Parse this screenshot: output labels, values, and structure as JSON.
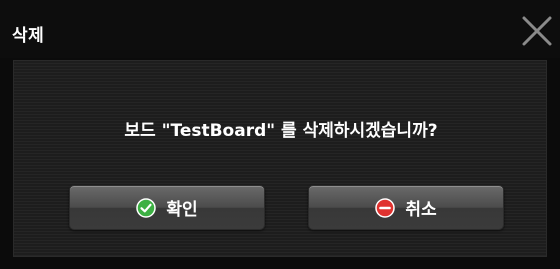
{
  "dialog": {
    "title": "삭제",
    "message": "보드 \"TestBoard\" 를 삭제하시겠습니까?",
    "buttons": {
      "confirm_label": "확인",
      "cancel_label": "취소"
    },
    "icons": {
      "close": "close-icon",
      "confirm": "check-circle-icon",
      "cancel": "minus-circle-icon"
    },
    "colors": {
      "confirm_icon": "#3cb043",
      "cancel_icon": "#e0322f"
    }
  }
}
